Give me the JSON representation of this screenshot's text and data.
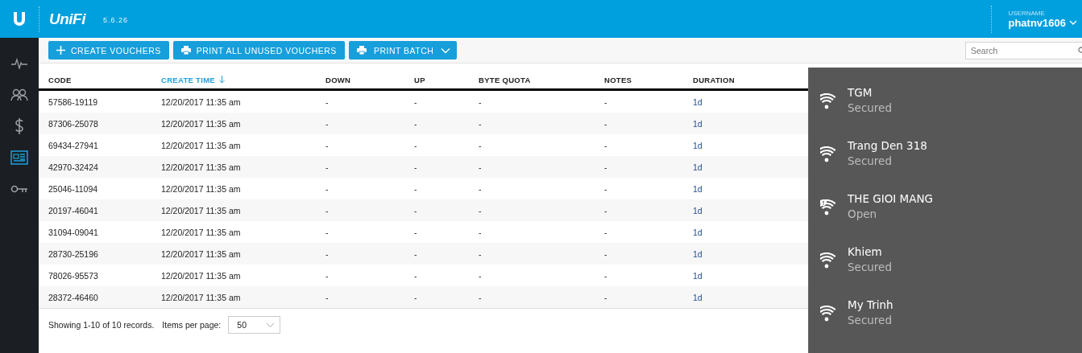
{
  "header": {
    "brand": "UniFi",
    "version": "5.6.26",
    "user_label": "USERNAME",
    "username": "phatnv1606"
  },
  "sidebar": {
    "items": [
      {
        "kind": "stats",
        "selected": false
      },
      {
        "kind": "clients",
        "selected": false
      },
      {
        "kind": "billing",
        "selected": false
      },
      {
        "kind": "vouchers",
        "selected": true
      },
      {
        "kind": "admin",
        "selected": false
      }
    ]
  },
  "toolbar": {
    "buttons": [
      {
        "kind": "add",
        "label": "CREATE VOUCHERS",
        "dropdown": false
      },
      {
        "kind": "print",
        "label": "PRINT ALL UNUSED VOUCHERS",
        "dropdown": false
      },
      {
        "kind": "print",
        "label": "PRINT BATCH",
        "dropdown": true
      }
    ],
    "search": {
      "placeholder": "Search"
    }
  },
  "table": {
    "columns": [
      {
        "label": "CODE",
        "sorted": false
      },
      {
        "label": "CREATE TIME",
        "sorted": true
      },
      {
        "label": "DOWN",
        "sorted": false
      },
      {
        "label": "UP",
        "sorted": false
      },
      {
        "label": "BYTE QUOTA",
        "sorted": false
      },
      {
        "label": "NOTES",
        "sorted": false
      },
      {
        "label": "DURATION",
        "sorted": false
      }
    ],
    "rows": [
      [
        "57586-19119",
        "12/20/2017 11:35 am",
        "-",
        "-",
        "-",
        "-",
        "1d"
      ],
      [
        "87306-25078",
        "12/20/2017 11:35 am",
        "-",
        "-",
        "-",
        "-",
        "1d"
      ],
      [
        "69434-27941",
        "12/20/2017 11:35 am",
        "-",
        "-",
        "-",
        "-",
        "1d"
      ],
      [
        "42970-32424",
        "12/20/2017 11:35 am",
        "-",
        "-",
        "-",
        "-",
        "1d"
      ],
      [
        "25046-11094",
        "12/20/2017 11:35 am",
        "-",
        "-",
        "-",
        "-",
        "1d"
      ],
      [
        "20197-46041",
        "12/20/2017 11:35 am",
        "-",
        "-",
        "-",
        "-",
        "1d"
      ],
      [
        "31094-09041",
        "12/20/2017 11:35 am",
        "-",
        "-",
        "-",
        "-",
        "1d"
      ],
      [
        "28730-25196",
        "12/20/2017 11:35 am",
        "-",
        "-",
        "-",
        "-",
        "1d"
      ],
      [
        "78026-95573",
        "12/20/2017 11:35 am",
        "-",
        "-",
        "-",
        "-",
        "1d"
      ],
      [
        "28372-46460",
        "12/20/2017 11:35 am",
        "-",
        "-",
        "-",
        "-",
        "1d"
      ]
    ]
  },
  "footer": {
    "summary": "Showing 1-10 of 10 records.",
    "per_page_label": "Items per page:",
    "per_page": "50"
  },
  "wifi_flyout": {
    "networks": [
      {
        "name": "TGM",
        "status": "Secured",
        "warning": false
      },
      {
        "name": "Trang Den 318",
        "status": "Secured",
        "warning": false
      },
      {
        "name": "THE GIOI MANG",
        "status": "Open",
        "warning": true
      },
      {
        "name": "Khiem",
        "status": "Secured",
        "warning": false
      },
      {
        "name": "My Trinh",
        "status": "Secured",
        "warning": false
      }
    ]
  }
}
